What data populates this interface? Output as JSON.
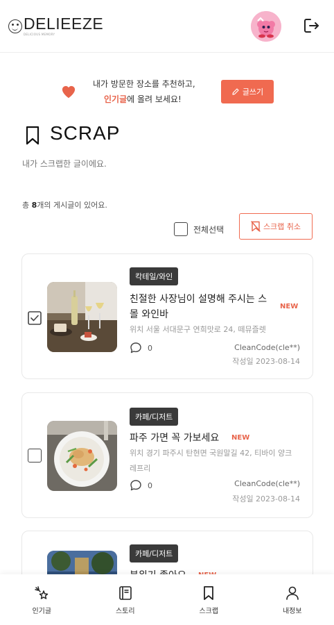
{
  "header": {
    "logo_text": "DELIEEZE",
    "logo_sub": "DELICIOUS MEMORY"
  },
  "banner": {
    "line1": "내가 방문한 장소를 추천하고,",
    "line2_highlight": "인기글",
    "line2_rest": "에 올려 보세요!",
    "write_button": "글쓰기"
  },
  "section": {
    "title": "SCRAP",
    "subtitle": "내가 스크랩한 글이에요.",
    "count_prefix": "총 ",
    "count": "8",
    "count_suffix": "개의 게시글이 있어요.",
    "select_all_label": "전체선택",
    "cancel_button": "스크랩 취소"
  },
  "posts": [
    {
      "category": "칵테일/와인",
      "title": "친절한 사장님이 설명해 주시는 스몰 와인바",
      "badge": "NEW",
      "address": "위치 서울 서대문구 연희맛로 24, 떼뮤즐렛",
      "comments": "0",
      "author": "CleanCode(cle**)",
      "date": "작성일 2023-08-14",
      "checked": true
    },
    {
      "category": "카페/디저트",
      "title": "파주 가면 꼭 가보세요",
      "badge": "NEW",
      "address": "위치 경기 파주시 탄현면 국원말길 42, 티바이 양크레프리",
      "comments": "0",
      "author": "CleanCode(cle**)",
      "date": "작성일 2023-08-14",
      "checked": false
    },
    {
      "category": "카페/디저트",
      "title": "분위기 좋아요",
      "badge": "NEW",
      "checked": false
    }
  ],
  "nav": [
    {
      "label": "인기글",
      "icon": "sparkles-icon"
    },
    {
      "label": "스토리",
      "icon": "book-icon"
    },
    {
      "label": "스크랩",
      "icon": "bookmark-icon"
    },
    {
      "label": "내정보",
      "icon": "user-icon"
    }
  ],
  "colors": {
    "accent": "#f06a50",
    "dark_badge": "#3a3a3a"
  }
}
